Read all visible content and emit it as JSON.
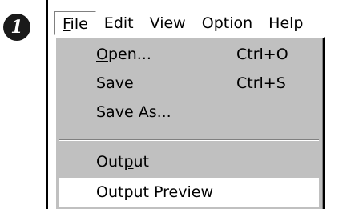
{
  "step_marker": "1",
  "menubar": {
    "items": [
      {
        "pre": "",
        "key": "F",
        "post": "ile"
      },
      {
        "pre": "",
        "key": "E",
        "post": "dit"
      },
      {
        "pre": "",
        "key": "V",
        "post": "iew"
      },
      {
        "pre": "",
        "key": "O",
        "post": "ption"
      },
      {
        "pre": "",
        "key": "H",
        "post": "elp"
      }
    ]
  },
  "file_menu": {
    "items": [
      {
        "pre": "",
        "key": "O",
        "post": "pen...",
        "shortcut": "Ctrl+O"
      },
      {
        "pre": "",
        "key": "S",
        "post": "ave",
        "shortcut": "Ctrl+S"
      },
      {
        "pre": "Save ",
        "key": "A",
        "post": "s...",
        "shortcut": ""
      },
      {
        "pre": "Out",
        "key": "p",
        "post": "ut",
        "shortcut": ""
      },
      {
        "pre": "Output Pre",
        "key": "v",
        "post": "iew",
        "shortcut": ""
      }
    ]
  }
}
